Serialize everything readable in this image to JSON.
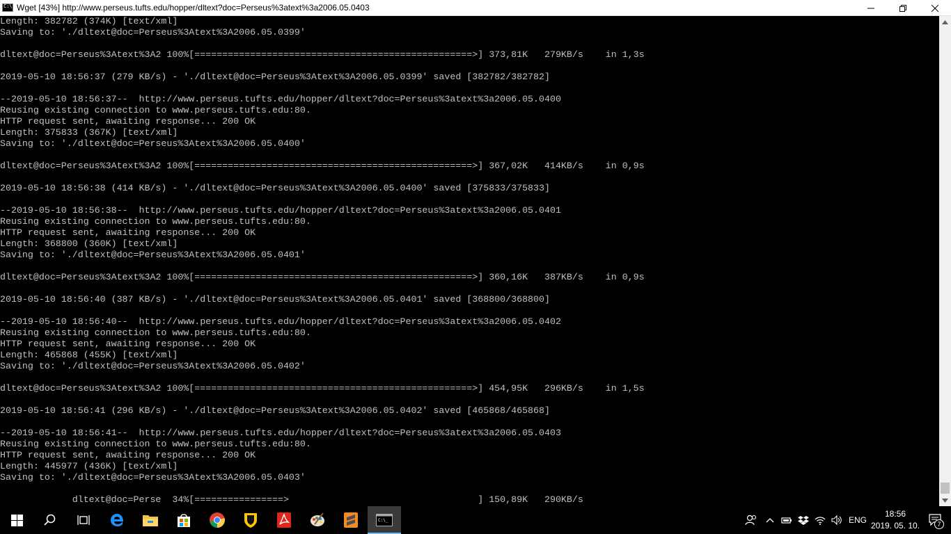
{
  "window": {
    "title": "Wget [43%] http://www.perseus.tufts.edu/hopper/dltext?doc=Perseus%3atext%3a2006.05.0403",
    "icon": "cmd-icon"
  },
  "console": {
    "lines": [
      "Length: 382782 (374K) [text/xml]",
      "Saving to: './dltext@doc=Perseus%3Atext%3A2006.05.0399'",
      "",
      "dltext@doc=Perseus%3Atext%3A2 100%[==================================================>] 373,81K   279KB/s    in 1,3s",
      "",
      "2019-05-10 18:56:37 (279 KB/s) - './dltext@doc=Perseus%3Atext%3A2006.05.0399' saved [382782/382782]",
      "",
      "--2019-05-10 18:56:37--  http://www.perseus.tufts.edu/hopper/dltext?doc=Perseus%3atext%3a2006.05.0400",
      "Reusing existing connection to www.perseus.tufts.edu:80.",
      "HTTP request sent, awaiting response... 200 OK",
      "Length: 375833 (367K) [text/xml]",
      "Saving to: './dltext@doc=Perseus%3Atext%3A2006.05.0400'",
      "",
      "dltext@doc=Perseus%3Atext%3A2 100%[==================================================>] 367,02K   414KB/s    in 0,9s",
      "",
      "2019-05-10 18:56:38 (414 KB/s) - './dltext@doc=Perseus%3Atext%3A2006.05.0400' saved [375833/375833]",
      "",
      "--2019-05-10 18:56:38--  http://www.perseus.tufts.edu/hopper/dltext?doc=Perseus%3atext%3a2006.05.0401",
      "Reusing existing connection to www.perseus.tufts.edu:80.",
      "HTTP request sent, awaiting response... 200 OK",
      "Length: 368800 (360K) [text/xml]",
      "Saving to: './dltext@doc=Perseus%3Atext%3A2006.05.0401'",
      "",
      "dltext@doc=Perseus%3Atext%3A2 100%[==================================================>] 360,16K   387KB/s    in 0,9s",
      "",
      "2019-05-10 18:56:40 (387 KB/s) - './dltext@doc=Perseus%3Atext%3A2006.05.0401' saved [368800/368800]",
      "",
      "--2019-05-10 18:56:40--  http://www.perseus.tufts.edu/hopper/dltext?doc=Perseus%3atext%3a2006.05.0402",
      "Reusing existing connection to www.perseus.tufts.edu:80.",
      "HTTP request sent, awaiting response... 200 OK",
      "Length: 465868 (455K) [text/xml]",
      "Saving to: './dltext@doc=Perseus%3Atext%3A2006.05.0402'",
      "",
      "dltext@doc=Perseus%3Atext%3A2 100%[==================================================>] 454,95K   296KB/s    in 1,5s",
      "",
      "2019-05-10 18:56:41 (296 KB/s) - './dltext@doc=Perseus%3Atext%3A2006.05.0402' saved [465868/465868]",
      "",
      "--2019-05-10 18:56:41--  http://www.perseus.tufts.edu/hopper/dltext?doc=Perseus%3atext%3a2006.05.0403",
      "Reusing existing connection to www.perseus.tufts.edu:80.",
      "HTTP request sent, awaiting response... 200 OK",
      "Length: 445977 (436K) [text/xml]",
      "Saving to: './dltext@doc=Perseus%3Atext%3A2006.05.0403'",
      "",
      "             dltext@doc=Perse  34%[================>                                  ] 150,89K   290KB/s"
    ]
  },
  "taskbar": {
    "apps": [
      {
        "name": "start-button",
        "icon": "windows-logo-icon",
        "active": false
      },
      {
        "name": "search-button",
        "icon": "search-icon",
        "active": false
      },
      {
        "name": "task-view-button",
        "icon": "task-view-icon",
        "active": false
      },
      {
        "name": "taskbar-edge",
        "icon": "edge-icon",
        "active": false
      },
      {
        "name": "taskbar-file-explorer",
        "icon": "folder-icon",
        "active": false
      },
      {
        "name": "taskbar-store",
        "icon": "store-icon",
        "active": false
      },
      {
        "name": "taskbar-chrome",
        "icon": "chrome-icon",
        "active": false
      },
      {
        "name": "taskbar-shield-app",
        "icon": "shield-icon",
        "active": false
      },
      {
        "name": "taskbar-acrobat",
        "icon": "pdf-icon",
        "active": false
      },
      {
        "name": "taskbar-paint",
        "icon": "palette-icon",
        "active": false
      },
      {
        "name": "taskbar-sublime",
        "icon": "sublime-icon",
        "active": false
      },
      {
        "name": "taskbar-cmd",
        "icon": "cmd-icon",
        "active": true
      }
    ],
    "tray": {
      "language": "ENG",
      "time": "18:56",
      "date": "2019. 05. 10.",
      "notification_count": "7"
    }
  },
  "colors": {
    "console_bg": "#000000",
    "console_fg": "#c0c0c0",
    "taskbar_bg": "#000000",
    "active_indicator": "#76b9ed"
  }
}
